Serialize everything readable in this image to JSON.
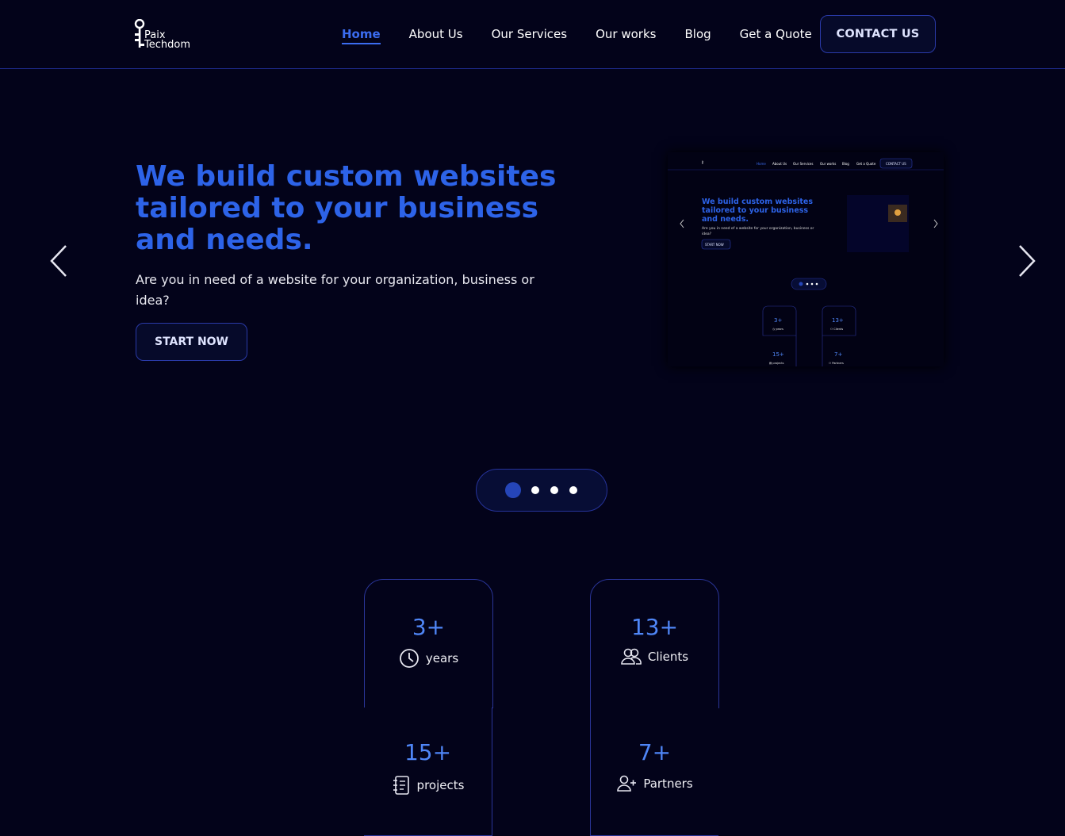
{
  "logo": {
    "line1": "Paix",
    "line2": "Techdom"
  },
  "nav": {
    "items": [
      "Home",
      "About Us",
      "Our Services",
      "Our works",
      "Blog",
      "Get a Quote"
    ],
    "contact_label": "CONTACT US"
  },
  "hero": {
    "title": "We build custom websites tailored to your business and needs.",
    "subtitle": "Are you in need of a website for your organization, business or idea?",
    "cta_label": "START NOW"
  },
  "preview": {
    "nav_items": [
      "Home",
      "About Us",
      "Our Services",
      "Our works",
      "Blog",
      "Get a Quote"
    ],
    "contact_label": "CONTACT US",
    "title": "We build custom websites tailored to your business and needs.",
    "subtitle": "Are you in need of a website for your organization, business or idea?",
    "cta_label": "START NOW"
  },
  "carousel": {
    "slide_count": 4,
    "active_index": 0
  },
  "stats": [
    {
      "value": "3+",
      "label": "years",
      "icon": "clock-icon"
    },
    {
      "value": "13+",
      "label": "Clients",
      "icon": "users-icon"
    },
    {
      "value": "15+",
      "label": "projects",
      "icon": "notebook-icon"
    },
    {
      "value": "7+",
      "label": "Partners",
      "icon": "user-plus-icon"
    }
  ],
  "colors": {
    "background": "#03031a",
    "accent": "#2d63e8",
    "border": "#2a3598",
    "stat_number": "#4f86f7"
  }
}
